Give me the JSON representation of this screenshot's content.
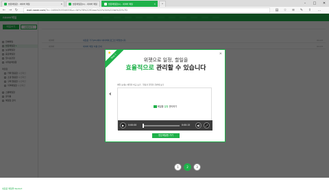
{
  "browser": {
    "tabs": [
      {
        "label": "받은메일함 - 네이버 메일"
      },
      {
        "label": "받은메일함(1) - 네이버 메일"
      },
      {
        "label": "받은메일함(1) - 네이버 메일"
      }
    ],
    "url_prefix": "mail.naver.com",
    "url_rest": "/?n=1480430334633&v=f#%7B%22fClass%22%3A%22list%22%7D"
  },
  "app": {
    "brand": "naver메일"
  },
  "sidebar": {
    "write_label": "메일쓰기",
    "self_label": "내게쓰기",
    "items": [
      {
        "label": "전체메일"
      },
      {
        "label": "받은메일함",
        "count": "1"
      },
      {
        "label": "보낸메일함"
      },
      {
        "label": "중요메일함"
      },
      {
        "label": "임시보관함"
      },
      {
        "label": "내게쓴메일함"
      }
    ],
    "group_label": "메일함",
    "folders": [
      {
        "label": "카페 알림함",
        "count": "수신확인"
      },
      {
        "label": "소셜 알림함",
        "count": "수신확인"
      },
      {
        "label": "구매 알림함",
        "count": "수신확인"
      },
      {
        "label": "지역메일함",
        "count": "수신확인"
      }
    ],
    "extras": [
      {
        "label": "스팸메일함"
      },
      {
        "label": "휴지통"
      },
      {
        "label": "메일함 관리"
      }
    ],
    "footer": "새로운 메일을 Restart"
  },
  "main": {
    "rows": [
      {
        "from": "네이버",
        "subject": "새로운 기기(PC)에서 네이버에 로그인 되었습니다.",
        "date": "02-03"
      },
      {
        "from": "네이버",
        "subject": "네이버 메일 이용 안내",
        "date": "02-03"
      }
    ]
  },
  "modal": {
    "ribbon": "Step 1",
    "close": "✕",
    "title_line1": "위젯으로 일정, 할일을",
    "title_hl": "효율적으로",
    "title_rest": " 관리할 수 있습니다",
    "caption": "메일 보내는 메일을 비교 보기 · 일정과 할일을 한번에 보기",
    "video_text_a": "메일을 ",
    "video_text_b": "일정 ",
    "video_text_c": "관리하기",
    "time_current": "0:00:00",
    "time_total": "0:00:15",
    "progress": 0.0,
    "cta": "받은메일함 가기"
  },
  "pager": {
    "pages": [
      "1",
      "2",
      "3"
    ],
    "current": "2"
  },
  "colors": {
    "accent": "#1fb14a",
    "overlay": "rgba(0,0,0,0.6)"
  }
}
